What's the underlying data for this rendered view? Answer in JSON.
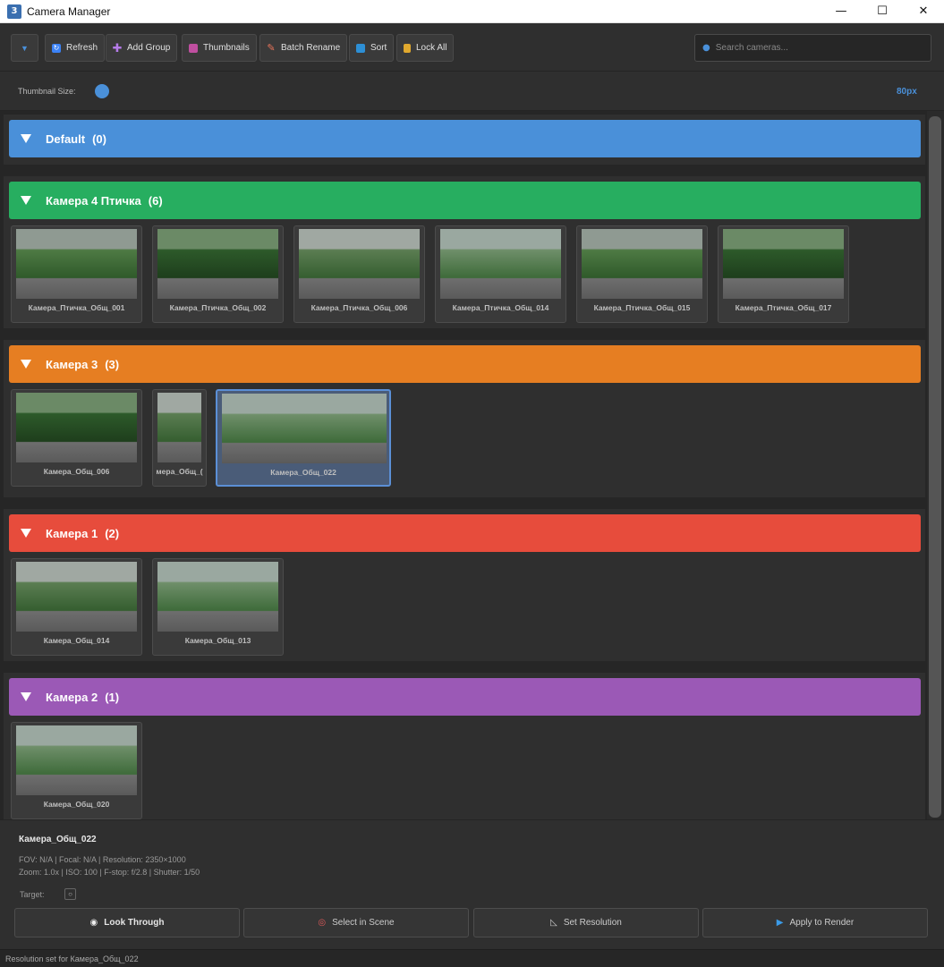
{
  "window": {
    "title": "Camera Manager",
    "icon_name": "app-3d-icon",
    "minimize": "—",
    "maximize": "☐",
    "close": "✕"
  },
  "toolbar": {
    "collapse_label": "▼",
    "buttons": [
      {
        "label": "Refresh",
        "icon": "refresh-icon"
      },
      {
        "label": "Add Group",
        "icon": "plus-icon"
      },
      {
        "label": "Thumbnails",
        "icon": "camera-icon"
      },
      {
        "label": "Batch Rename",
        "icon": "pencil-icon"
      },
      {
        "label": "Sort",
        "icon": "sort-icon"
      },
      {
        "label": "Lock All",
        "icon": "lock-icon"
      }
    ],
    "search_placeholder": "Search cameras..."
  },
  "slider": {
    "label": "Thumbnail Size:",
    "value_text": "80px",
    "value": 80
  },
  "groups": [
    {
      "name": "Default",
      "count": "(0)",
      "color": "#4a90d9",
      "cameras": []
    },
    {
      "name": "Камера 4 Птичка",
      "count": "(6)",
      "color": "#27ae60",
      "cameras": [
        "Камера_Птичка_Общ_001",
        "Камера_Птичка_Общ_002",
        "Камера_Птичка_Общ_006",
        "Камера_Птичка_Общ_014",
        "Камера_Птичка_Общ_015",
        "Камера_Птичка_Общ_017"
      ]
    },
    {
      "name": "Камера 3",
      "count": "(3)",
      "color": "#e67e22",
      "cameras": [
        "Камера_Общ_006",
        "мера_Общ_(",
        "Камера_Общ_022"
      ]
    },
    {
      "name": "Камера 1",
      "count": "(2)",
      "color": "#e74c3c",
      "cameras": [
        "Камера_Общ_014",
        "Камера_Общ_013"
      ]
    },
    {
      "name": "Камера 2",
      "count": "(1)",
      "color": "#9b59b6",
      "cameras": [
        "Камера_Общ_020"
      ]
    }
  ],
  "details": {
    "name": "Камера_Общ_022",
    "line1": "FOV: N/A  |  Focal: N/A  |  Resolution: 2350×1000",
    "line2": "Zoom: 1.0x  |  ISO: 100  |  F-stop: f/2.8  |  Shutter: 1/50",
    "target_label": "Target:",
    "target_button": "○"
  },
  "actions": [
    {
      "label": "Look Through",
      "icon": "eye-icon",
      "glyph": "◉"
    },
    {
      "label": "Select in Scene",
      "icon": "target-icon",
      "glyph": "◎"
    },
    {
      "label": "Set Resolution",
      "icon": "ruler-icon",
      "glyph": "◺"
    },
    {
      "label": "Apply to Render",
      "icon": "play-icon",
      "glyph": "▶"
    }
  ],
  "status": "Resolution set for Камера_Общ_022",
  "colors": {
    "accent": "#4a90d9",
    "bg": "#2b2b2b"
  }
}
